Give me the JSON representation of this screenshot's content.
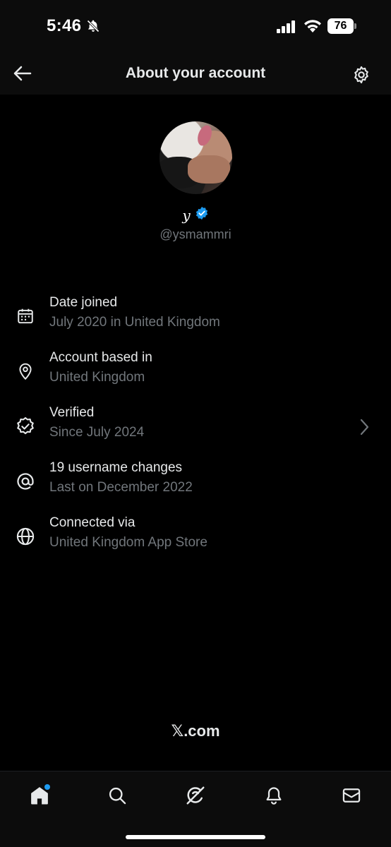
{
  "status_bar": {
    "time": "5:46",
    "battery": "76",
    "icons": [
      "bell-off-icon",
      "signal-icon",
      "wifi-icon",
      "battery-icon"
    ]
  },
  "header": {
    "title": "About your account",
    "back_icon": "arrow-left-icon",
    "settings_icon": "gear-icon"
  },
  "profile": {
    "display_name": "y",
    "handle": "@ysmammri",
    "verified": true,
    "verified_color": "#1d9bf0"
  },
  "info_items": [
    {
      "icon": "calendar-icon",
      "title": "Date joined",
      "subtitle": "July 2020 in United Kingdom",
      "has_chevron": false
    },
    {
      "icon": "location-pin-icon",
      "title": "Account based in",
      "subtitle": "United Kingdom",
      "has_chevron": false
    },
    {
      "icon": "verified-badge-icon",
      "title": "Verified",
      "subtitle": "Since July 2024",
      "has_chevron": true
    },
    {
      "icon": "at-sign-icon",
      "title": "19 username changes",
      "subtitle": "Last on December 2022",
      "has_chevron": false
    },
    {
      "icon": "globe-icon",
      "title": "Connected via",
      "subtitle": "United Kingdom App Store",
      "has_chevron": false
    }
  ],
  "footer": {
    "logo_mark": "𝕏",
    "logo_text": ".com"
  },
  "tab_bar": {
    "tabs": [
      "home-icon",
      "search-icon",
      "grok-icon",
      "notifications-icon",
      "messages-icon"
    ],
    "active": "home-icon",
    "accent": "#1d9bf0"
  },
  "colors": {
    "background": "#000000",
    "primary_text": "#e7e9ea",
    "secondary_text": "#71767b"
  }
}
